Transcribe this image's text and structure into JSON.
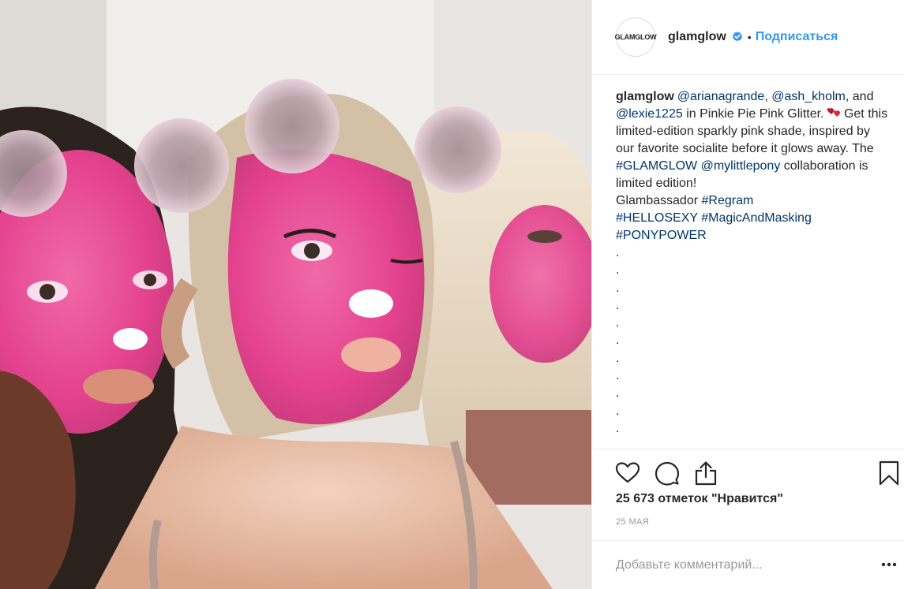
{
  "post": {
    "photo_alt": "",
    "header": {
      "avatar_text": "GLAMGLOW",
      "username": "glamglow",
      "separator": "•",
      "follow_label": "Подписаться"
    },
    "caption": {
      "username": "glamglow",
      "mention_1": "@arianagrande",
      "comma_1": ",",
      "mention_2": "@ash_kholm",
      "comma_2": ",",
      "and_text": "and",
      "mention_3": "@lexie1225",
      "text_1": "in Pinkie Pie Pink Glitter.",
      "text_2": "Get this limited-edition sparkly pink shade, inspired by our favorite socialite before it glows away. The",
      "hashtag_1": "#GLAMGLOW",
      "mention_4": "@mylittlepony",
      "text_3": "collaboration is limited edition!",
      "text_4": "Glambassador",
      "hashtag_2": "#Regram",
      "hashtag_3": "#HELLOSEXY",
      "hashtag_4": "#MagicAndMasking",
      "hashtag_5": "#PONYPOWER",
      "dots": [
        ".",
        ".",
        ".",
        ".",
        ".",
        ".",
        ".",
        ".",
        ".",
        ".",
        "."
      ]
    },
    "actions": {
      "like_icon": "heart-outline-icon",
      "comment_icon": "comment-bubble-icon",
      "share_icon": "share-upload-icon",
      "save_icon": "bookmark-icon"
    },
    "likes_text": "25 673 отметок \"Нравится\"",
    "date": "25 мая",
    "comment": {
      "placeholder": "Добавьте комментарий...",
      "more_icon": "ellipsis-icon"
    }
  },
  "colors": {
    "link": "#003569",
    "follow": "#3897f0",
    "verified": "#3897f0",
    "text": "#262626",
    "muted": "#999999",
    "border": "#efefef"
  }
}
